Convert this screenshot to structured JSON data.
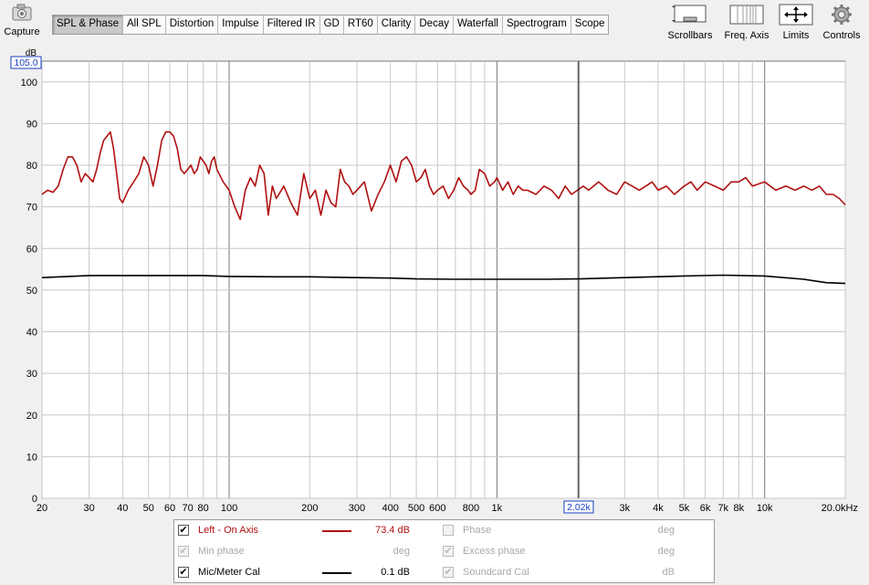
{
  "toolbar": {
    "capture_label": "Capture",
    "scrollbars_label": "Scrollbars",
    "freq_axis_label": "Freq. Axis",
    "limits_label": "Limits",
    "controls_label": "Controls"
  },
  "tabs": [
    {
      "label": "SPL & Phase",
      "active": true
    },
    {
      "label": "All SPL"
    },
    {
      "label": "Distortion"
    },
    {
      "label": "Impulse"
    },
    {
      "label": "Filtered IR"
    },
    {
      "label": "GD"
    },
    {
      "label": "RT60"
    },
    {
      "label": "Clarity"
    },
    {
      "label": "Decay"
    },
    {
      "label": "Waterfall"
    },
    {
      "label": "Spectrogram"
    },
    {
      "label": "Scope"
    }
  ],
  "chart_data": {
    "type": "line",
    "y_unit": "dB",
    "y_top_readout": "105.0",
    "x_scale": "log",
    "xlim": [
      20,
      20000
    ],
    "ylim": [
      0,
      105
    ],
    "y_ticks": [
      0,
      10,
      20,
      30,
      40,
      50,
      60,
      70,
      80,
      90,
      100
    ],
    "x_tick_labels": [
      {
        "value": 20,
        "label": "20"
      },
      {
        "value": 30,
        "label": "30"
      },
      {
        "value": 40,
        "label": "40"
      },
      {
        "value": 50,
        "label": "50"
      },
      {
        "value": 60,
        "label": "60"
      },
      {
        "value": 70,
        "label": "70"
      },
      {
        "value": 80,
        "label": "80"
      },
      {
        "value": 100,
        "label": "100"
      },
      {
        "value": 200,
        "label": "200"
      },
      {
        "value": 300,
        "label": "300"
      },
      {
        "value": 400,
        "label": "400"
      },
      {
        "value": 500,
        "label": "500"
      },
      {
        "value": 600,
        "label": "600"
      },
      {
        "value": 800,
        "label": "800"
      },
      {
        "value": 1000,
        "label": "1k"
      },
      {
        "value": 3000,
        "label": "3k"
      },
      {
        "value": 4000,
        "label": "4k"
      },
      {
        "value": 5000,
        "label": "5k"
      },
      {
        "value": 6000,
        "label": "6k"
      },
      {
        "value": 7000,
        "label": "7k"
      },
      {
        "value": 8000,
        "label": "8k"
      },
      {
        "value": 10000,
        "label": "10k"
      },
      {
        "value": 20000,
        "label": "20.0kHz"
      }
    ],
    "cursor": {
      "value": 2020,
      "label": "2.02k"
    },
    "grid": true,
    "series": [
      {
        "name": "Left - On Axis",
        "color": "#b01010",
        "x": [
          20,
          21,
          22,
          23,
          24,
          25,
          26,
          27,
          28,
          29,
          30,
          31,
          32,
          33,
          34,
          35,
          36,
          37,
          38,
          39,
          40,
          42,
          44,
          46,
          48,
          50,
          52,
          54,
          56,
          58,
          60,
          62,
          64,
          66,
          68,
          70,
          72,
          74,
          76,
          78,
          80,
          82,
          84,
          86,
          88,
          90,
          95,
          100,
          105,
          110,
          115,
          120,
          125,
          130,
          135,
          140,
          145,
          150,
          160,
          170,
          180,
          190,
          200,
          210,
          220,
          230,
          240,
          250,
          260,
          270,
          280,
          290,
          300,
          320,
          340,
          360,
          380,
          400,
          420,
          440,
          460,
          480,
          500,
          520,
          540,
          560,
          580,
          600,
          630,
          660,
          690,
          720,
          750,
          780,
          800,
          830,
          860,
          900,
          940,
          980,
          1000,
          1050,
          1100,
          1150,
          1200,
          1250,
          1300,
          1400,
          1500,
          1600,
          1700,
          1800,
          1900,
          2000,
          2100,
          2200,
          2400,
          2600,
          2800,
          3000,
          3200,
          3400,
          3600,
          3800,
          4000,
          4300,
          4600,
          5000,
          5300,
          5600,
          6000,
          6500,
          7000,
          7500,
          8000,
          8500,
          9000,
          10000,
          11000,
          12000,
          13000,
          14000,
          15000,
          16000,
          17000,
          18000,
          19000,
          20000
        ],
        "values": [
          73,
          74,
          73.5,
          75,
          79,
          82,
          82,
          80,
          76,
          78,
          77,
          76,
          79,
          83,
          86,
          87,
          88,
          84,
          78,
          72,
          71,
          74,
          76,
          78,
          82,
          80,
          75,
          80,
          86,
          88,
          88,
          87,
          84,
          79,
          78,
          79,
          80,
          78,
          79,
          82,
          81,
          80,
          78,
          81,
          82,
          79,
          76,
          74,
          70,
          67,
          74,
          77,
          75,
          80,
          78,
          68,
          75,
          72,
          75,
          71,
          68,
          78,
          72,
          74,
          68,
          74,
          71,
          70,
          79,
          76,
          75,
          73,
          74,
          76,
          69,
          73,
          76,
          80,
          76,
          81,
          82,
          80,
          76,
          77,
          79,
          75,
          73,
          74,
          75,
          72,
          74,
          77,
          75,
          74,
          73,
          74,
          79,
          78,
          75,
          76,
          77,
          74,
          76,
          73,
          75,
          74,
          74,
          73,
          75,
          74,
          72,
          75,
          73,
          74,
          75,
          74,
          76,
          74,
          73,
          76,
          75,
          74,
          75,
          76,
          74,
          75,
          73,
          75,
          76,
          74,
          76,
          75,
          74,
          76,
          76,
          77,
          75,
          76,
          74,
          75,
          74,
          75,
          74,
          75,
          73,
          73,
          72,
          70.5
        ],
        "readout": "73.4 dB"
      },
      {
        "name": "Mic/Meter Cal",
        "color": "#000000",
        "x": [
          20,
          30,
          40,
          60,
          80,
          100,
          150,
          200,
          300,
          400,
          500,
          700,
          1000,
          1500,
          2000,
          3000,
          5000,
          7000,
          10000,
          14000,
          17000,
          20000
        ],
        "values": [
          53,
          53.5,
          53.5,
          53.5,
          53.5,
          53.3,
          53.2,
          53.2,
          53,
          52.9,
          52.7,
          52.6,
          52.6,
          52.6,
          52.7,
          53,
          53.4,
          53.6,
          53.4,
          52.6,
          51.8,
          51.6
        ],
        "readout": "0.1 dB"
      }
    ]
  },
  "legend": {
    "rows": [
      {
        "name": "Left - On Axis",
        "checked": true,
        "enabled": true,
        "color": "#b01010",
        "value": "73.4 dB"
      },
      {
        "name": "Min phase",
        "checked": true,
        "enabled": false,
        "value": "deg"
      },
      {
        "name": "Mic/Meter Cal",
        "checked": true,
        "enabled": true,
        "color": "#000000",
        "value": "0.1 dB"
      }
    ],
    "right_rows": [
      {
        "name": "Phase",
        "checked": false,
        "enabled": false,
        "value": "deg"
      },
      {
        "name": "Excess phase",
        "checked": true,
        "enabled": false,
        "value": "deg"
      },
      {
        "name": "Soundcard Cal",
        "checked": true,
        "enabled": false,
        "value": "dB"
      }
    ]
  }
}
